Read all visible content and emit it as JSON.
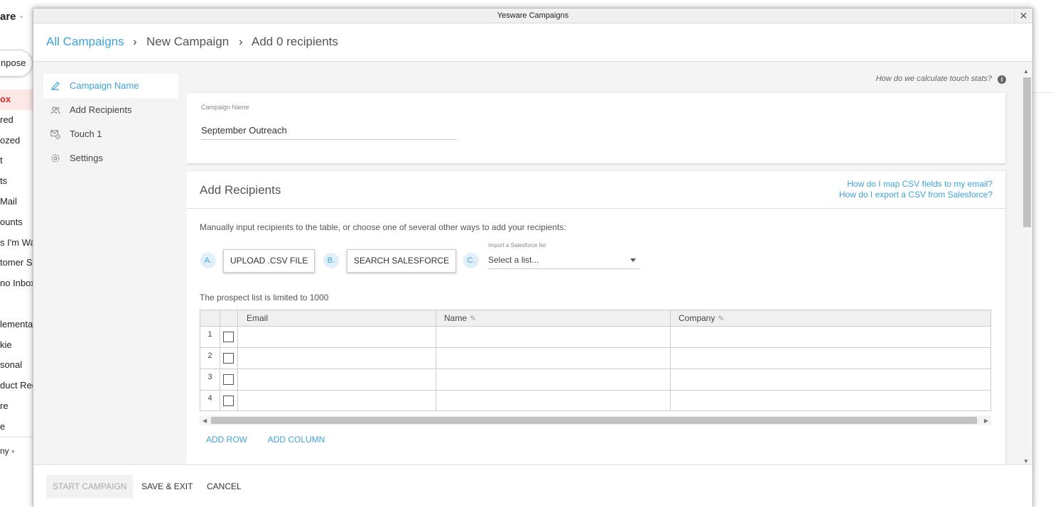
{
  "background": {
    "brand_text": "are",
    "compose_label": "npose",
    "nav_items": [
      "ox",
      "red",
      "ozed",
      "t",
      "ts",
      "Mail",
      "ounts",
      "s I'm Wa",
      "tomer Su",
      "no Inbox",
      "",
      "lementat",
      "kie",
      "sonal",
      "duct Req",
      "re",
      "e"
    ],
    "bottom_label": "ny"
  },
  "window": {
    "title": "Yesware Campaigns",
    "close_glyph": "✕"
  },
  "breadcrumb": {
    "items": [
      "All Campaigns",
      "New Campaign",
      "Add 0 recipients"
    ],
    "separator": "›"
  },
  "sidebar": {
    "items": [
      {
        "label": "Campaign Name",
        "icon": "pencil-icon",
        "active": true
      },
      {
        "label": "Add Recipients",
        "icon": "people-icon",
        "active": false
      },
      {
        "label": "Touch 1",
        "icon": "mail-clock-icon",
        "active": false
      },
      {
        "label": "Settings",
        "icon": "gear-icon",
        "active": false
      }
    ]
  },
  "help": {
    "stats_text": "How do we calculate touch stats?",
    "info_glyph": "i"
  },
  "campaign_name": {
    "label": "Campaign Name",
    "value": "September Outreach"
  },
  "recipients": {
    "title": "Add Recipients",
    "link_csv_map": "How do I map CSV fields to my email?",
    "link_csv_export": "How do I export a CSV from Salesforce?",
    "instructions": "Manually input recipients to the table, or choose one of several other ways to add your recipients:",
    "option_a_letter": "A.",
    "option_a_button": "UPLOAD .CSV FILE",
    "option_b_letter": "B.",
    "option_b_button": "SEARCH SALESFORCE",
    "option_c_letter": "C.",
    "sf_list_label": "Import a Salesforce list",
    "sf_list_placeholder": "Select a list...",
    "limit_text": "The prospect list is limited to 1000",
    "columns": [
      "Email",
      "Name",
      "Company"
    ],
    "rows": [
      "1",
      "2",
      "3",
      "4"
    ],
    "add_row": "ADD ROW",
    "add_column": "ADD COLUMN"
  },
  "footer": {
    "start_campaign": "START CAMPAIGN",
    "save_exit": "SAVE & EXIT",
    "cancel": "CANCEL"
  }
}
